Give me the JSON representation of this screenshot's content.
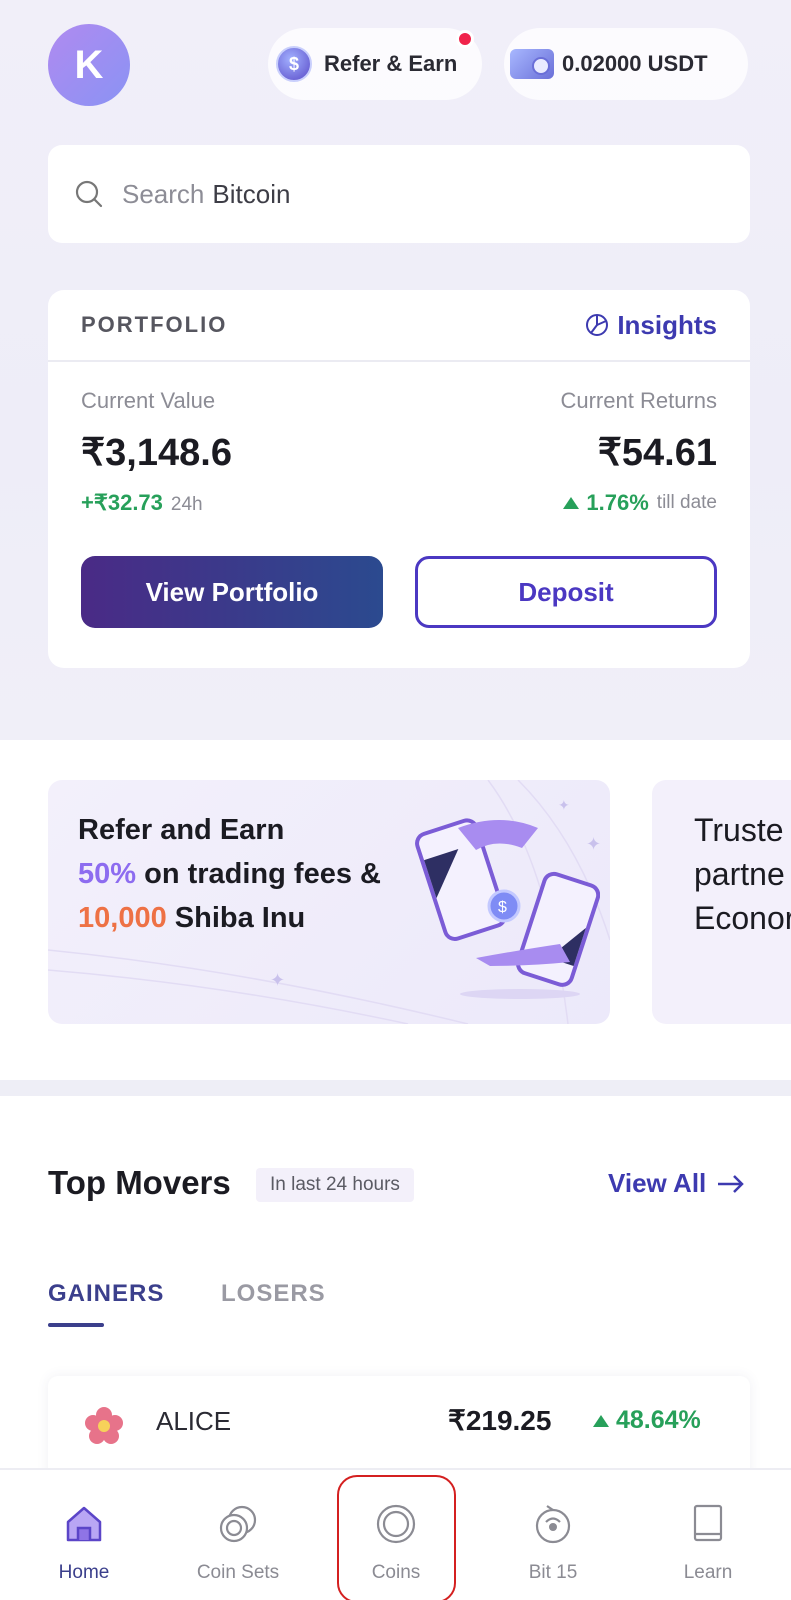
{
  "header": {
    "avatar_initial": "K",
    "refer_label": "Refer & Earn",
    "wallet_balance": "0.02000 USDT"
  },
  "search": {
    "placeholder": "Search",
    "term": "Bitcoin"
  },
  "portfolio": {
    "title": "PORTFOLIO",
    "insights_label": "Insights",
    "current_value_label": "Current Value",
    "current_value": "₹3,148.6",
    "change_24h": "+₹32.73",
    "change_24h_suffix": "24h",
    "current_returns_label": "Current Returns",
    "current_returns": "₹54.61",
    "returns_pct": "1.76%",
    "returns_suffix": "till date",
    "view_portfolio_label": "View Portfolio",
    "deposit_label": "Deposit"
  },
  "banners": [
    {
      "line1": "Refer and Earn",
      "line2_highlight": "50%",
      "line2_rest": " on trading fees &",
      "line3_highlight": "10,000",
      "line3_rest": " Shiba Inu"
    },
    {
      "line1": "Truste",
      "line2": "partne",
      "line3": "Econor"
    }
  ],
  "top_movers": {
    "title": "Top Movers",
    "tag": "In last 24 hours",
    "view_all_label": "View All",
    "tabs": [
      "GAINERS",
      "LOSERS"
    ],
    "rows": [
      {
        "name": "ALICE",
        "price": "₹219.25",
        "change": "48.64%"
      }
    ]
  },
  "nav": {
    "items": [
      {
        "label": "Home",
        "icon": "home-icon"
      },
      {
        "label": "Coin Sets",
        "icon": "coin-sets-icon"
      },
      {
        "label": "Coins",
        "icon": "coins-icon"
      },
      {
        "label": "Bit 15",
        "icon": "bit15-icon"
      },
      {
        "label": "Learn",
        "icon": "book-icon"
      }
    ],
    "active": "Home"
  },
  "colors": {
    "accent": "#3d3ab0",
    "positive": "#27a05a",
    "purple_highlight": "#8d6cf0",
    "orange_highlight": "#ee7145"
  }
}
